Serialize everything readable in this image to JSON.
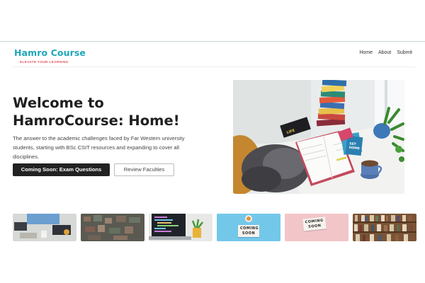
{
  "brand": {
    "name": "Hamro Course",
    "tagline": "ELEVATE YOUR LEARNING"
  },
  "nav": {
    "items": [
      "Home",
      "About",
      "Submit"
    ]
  },
  "hero": {
    "title": "Welcome to HamroCourse: Home!",
    "subtitle": "The answer to the academic challenges faced by Far Western university students, starting with BSc CSIT resources and expanding to cover all disciplines.",
    "primary_button": "Coming Soon: Exam Questions",
    "secondary_button": "Review Faculties",
    "photo_book_labels": {
      "black_book": "LIFE",
      "blue_book": "SET\nHOME"
    }
  },
  "thumbnails": [
    {
      "label": "workspace-desk-photo"
    },
    {
      "label": "city-aerial-photo"
    },
    {
      "label": "code-laptop-photo"
    },
    {
      "label": "coming-soon-blue",
      "text": "COMING\nSOON"
    },
    {
      "label": "coming-soon-pink",
      "text": "COMING\nSOON"
    },
    {
      "label": "bookshelf-photo"
    }
  ],
  "colors": {
    "brand": "#1ea7b8",
    "tagline": "#e44b5a",
    "primary_button": "#222222"
  }
}
